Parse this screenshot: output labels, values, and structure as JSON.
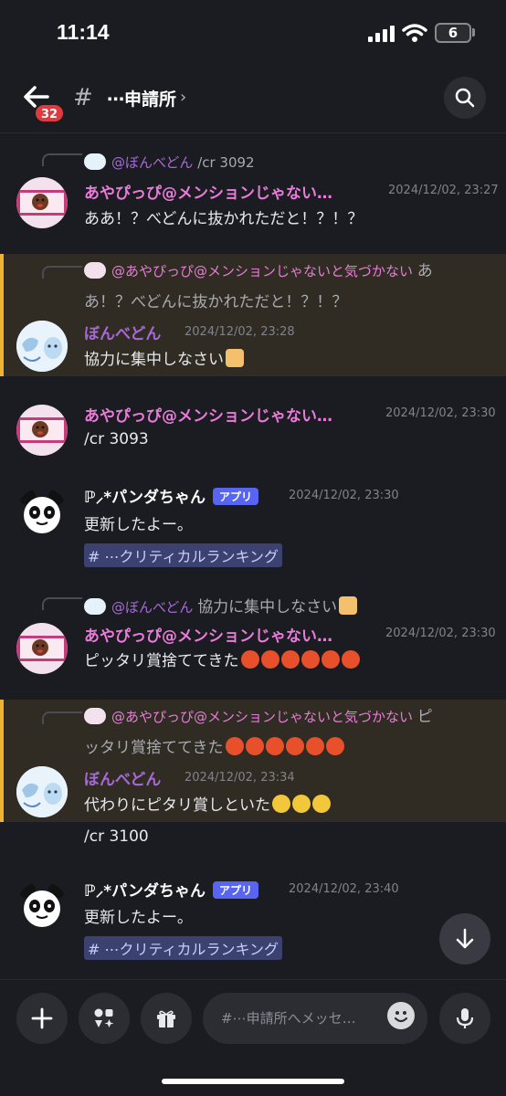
{
  "status": {
    "time": "11:14",
    "battery": "6"
  },
  "header": {
    "unread": "32",
    "channel": "⋯申請所",
    "chevron": "›"
  },
  "messages": {
    "m1": {
      "reply_user": "@ぼんべどん",
      "reply_text": "/cr 3092",
      "user": "あやぴっぴ@メンションじゃない…",
      "ts": "2024/12/02, 23:27",
      "text": "ああ！？べどんに抜かれただと！？！？"
    },
    "m2": {
      "reply_user": "@あやぴっぴ@メンションじゃないと気づかない",
      "reply_text_1": "あ",
      "reply_text_2": "あ！？べどんに抜かれただと！？！？",
      "user": "ぼんべどん",
      "ts": "2024/12/02, 23:28",
      "text": "協力に集中しなさい"
    },
    "m3": {
      "user": "あやぴっぴ@メンションじゃない…",
      "ts": "2024/12/02, 23:30",
      "text": "/cr 3093"
    },
    "m4": {
      "user": "ℙ⸝*パンダちゃん",
      "app": "アプリ",
      "ts": "2024/12/02, 23:30",
      "text": "更新したよー。",
      "mention": "#  ⋯クリティカルランキング"
    },
    "m5": {
      "reply_user": "@ぼんべどん",
      "reply_text": "協力に集中しなさい",
      "user": "あやぴっぴ@メンションじゃない…",
      "ts": "2024/12/02, 23:30",
      "text": "ピッタリ賞捨ててきた"
    },
    "m6": {
      "reply_user": "@あやぴっぴ@メンションじゃないと気づかない",
      "reply_text_1": "ピ",
      "reply_text_2": "ッタリ賞捨ててきた",
      "user": "ぼんべどん",
      "ts": "2024/12/02, 23:34",
      "text": "代わりにピタリ賞しといた"
    },
    "m7": {
      "text": "/cr 3100"
    },
    "m8": {
      "user": "ℙ⸝*パンダちゃん",
      "app": "アプリ",
      "ts": "2024/12/02, 23:40",
      "text": "更新したよー。",
      "mention": "#  ⋯クリティカルランキング"
    }
  },
  "composer": {
    "placeholder": "#⋯申請所へメッセ…"
  },
  "colors": {
    "accent": "#5865f2",
    "highlight_bar": "#f0b232",
    "pink_name": "#e97bd9",
    "purple_name": "#a66ad6"
  }
}
